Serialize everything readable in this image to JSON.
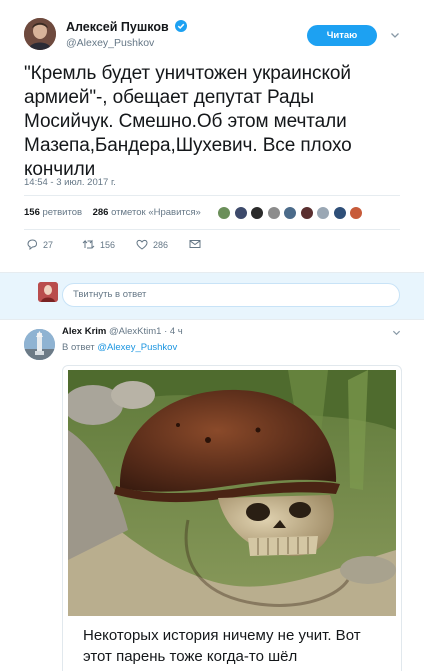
{
  "tweet": {
    "author_name": "Алексей Пушков",
    "author_handle": "@Alexey_Pushkov",
    "follow_label": "Читаю",
    "text": "\"Кремль будет уничтожен украинской армией\"-, обещает депутат Рады Мосийчук. Смешно.Об этом мечтали Мазепа,Бандера,Шухевич. Все плохо кончили",
    "timestamp": "14:54 - 3 июл. 2017 г.",
    "retweets_count": "156",
    "retweets_label": "ретвитов",
    "likes_count": "286",
    "likes_label": "отметок «Нравится»",
    "actions": {
      "replies": "27",
      "retweets": "156",
      "likes": "286"
    },
    "liker_colors": [
      "#6b8f5a",
      "#3d4a6b",
      "#2a2a2a",
      "#8c8c8c",
      "#4b6b8a",
      "#5a2f2f",
      "#9aa7b4",
      "#2e4f78",
      "#c75b3a"
    ]
  },
  "reply_composer": {
    "placeholder": "Твитнуть в ответ"
  },
  "reply": {
    "author_name": "Alex Krim",
    "author_handle": "@AlexKtim1",
    "age": "· 4 ч",
    "in_reply_prefix": "В ответ",
    "in_reply_mention": "@Alexey_Pushkov",
    "caption": "Некоторых история ничему не учит. Вот этот парень тоже когда-то шёл"
  },
  "colors": {
    "accent": "#1da1f2",
    "link": "#1b95e0",
    "secondary_text": "#657786",
    "reply_bg": "#e8f5fd"
  }
}
